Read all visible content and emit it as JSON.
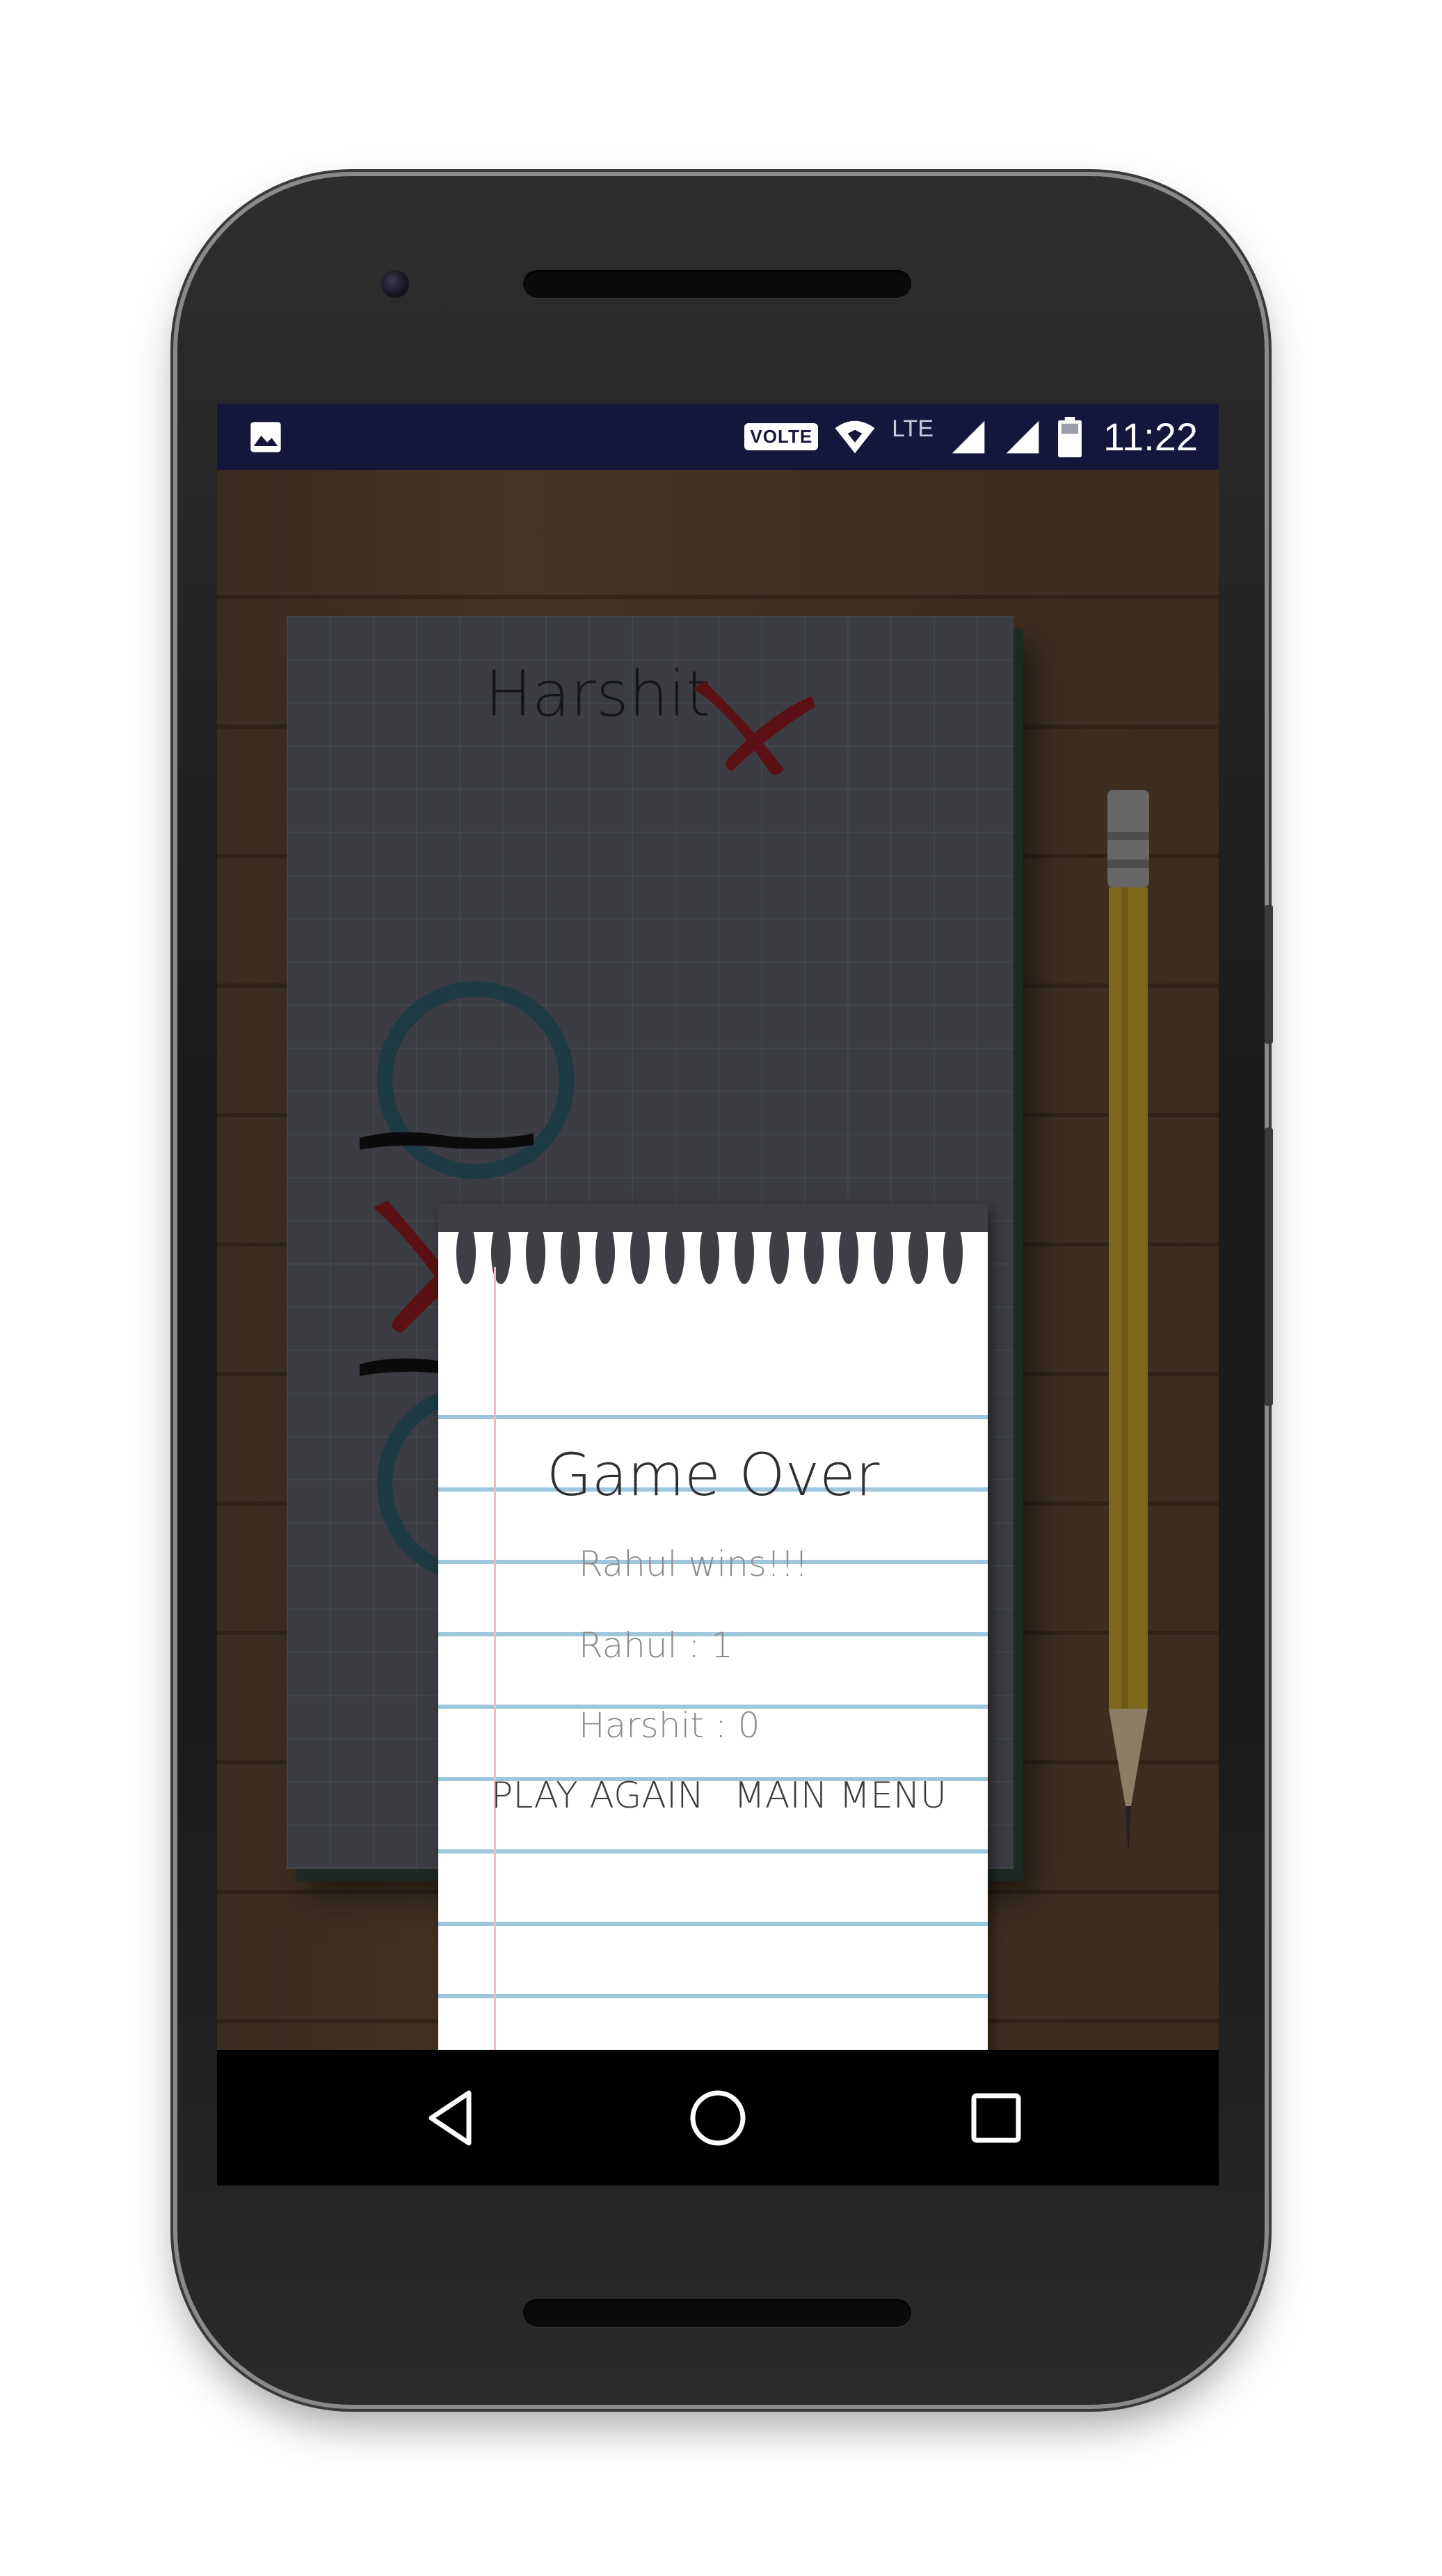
{
  "status_bar": {
    "volte_label": "VOLTE",
    "lte_label": "LTE",
    "time": "11:22",
    "icons": [
      "image-icon",
      "volte-icon",
      "wifi-icon",
      "lte-icon",
      "signal-icon",
      "signal-icon",
      "battery-icon"
    ]
  },
  "game": {
    "player_name": "Harshit",
    "pencil_color": "#e0b12a"
  },
  "dialog": {
    "title": "Game Over",
    "winner_text": "Rahul wins!!!",
    "score_player1": "Rahul : 1",
    "score_player2": "Harshit : 0",
    "play_again_label": "PLAY AGAIN",
    "main_menu_label": "MAIN MENU"
  },
  "nav_bar": {
    "icons": [
      "back-icon",
      "home-icon",
      "recents-icon"
    ]
  },
  "colors": {
    "status_bar_bg": "#14173b",
    "x_mark": "#8b1a1f",
    "o_mark": "#2f5a66",
    "notebook_rule": "#9cc7dc"
  }
}
